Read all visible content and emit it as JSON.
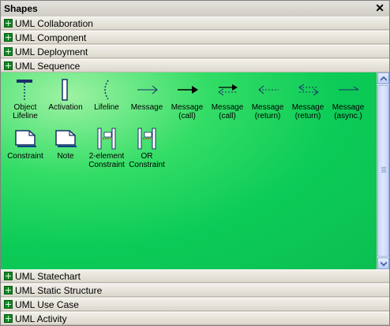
{
  "panel": {
    "title": "Shapes",
    "close": "✕"
  },
  "categories_top": [
    {
      "label": "UML Collaboration"
    },
    {
      "label": "UML Component"
    },
    {
      "label": "UML Deployment"
    },
    {
      "label": "UML Sequence"
    }
  ],
  "shapes": [
    {
      "label": "Object\nLifeline",
      "icon": "object-lifeline-icon"
    },
    {
      "label": "Activation",
      "icon": "activation-icon"
    },
    {
      "label": "Lifeline",
      "icon": "lifeline-icon"
    },
    {
      "label": "Message",
      "icon": "message-arrow-icon"
    },
    {
      "label": "Message\n(call)",
      "icon": "message-call-icon"
    },
    {
      "label": "Message\n(call)",
      "icon": "message-call-return-icon"
    },
    {
      "label": "Message\n(return)",
      "icon": "message-return-icon"
    },
    {
      "label": "Message\n(return)",
      "icon": "message-return-double-icon"
    },
    {
      "label": "Message\n(async.)",
      "icon": "message-async-icon"
    },
    {
      "label": "Constraint",
      "icon": "constraint-icon"
    },
    {
      "label": "Note",
      "icon": "note-icon"
    },
    {
      "label": "2-element\nConstraint",
      "icon": "two-element-constraint-icon"
    },
    {
      "label": "OR\nConstraint",
      "icon": "or-constraint-icon"
    }
  ],
  "categories_bottom": [
    {
      "label": "UML Statechart"
    },
    {
      "label": "UML Static Structure"
    },
    {
      "label": "UML Use Case"
    },
    {
      "label": "UML Activity"
    }
  ]
}
